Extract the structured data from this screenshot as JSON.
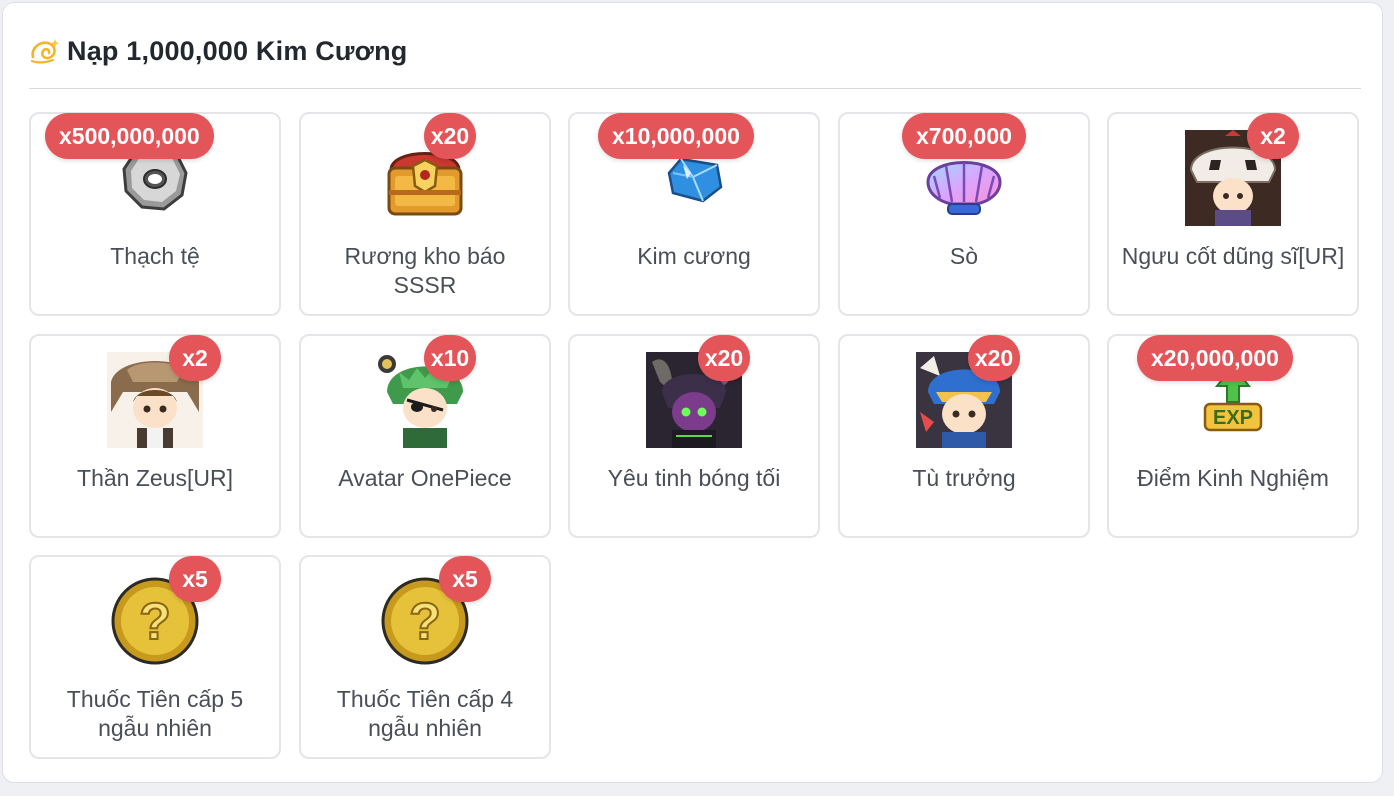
{
  "header": {
    "icon": "dizzy-icon",
    "title": "Nạp 1,000,000 Kim Cương"
  },
  "colors": {
    "badge": "#e4555a",
    "card_border": "#e3e5e9",
    "label_text": "#4a4f57"
  },
  "items": [
    {
      "name": "Thạch tệ",
      "qty": "x500,000,000",
      "icon": "stone-coin-icon"
    },
    {
      "name": "Rương kho báo SSSR",
      "qty": "x20",
      "icon": "treasure-chest-icon"
    },
    {
      "name": "Kim cương",
      "qty": "x10,000,000",
      "icon": "diamond-icon"
    },
    {
      "name": "Sò",
      "qty": "x700,000",
      "icon": "seashell-icon"
    },
    {
      "name": "Ngưu cốt dũng sĩ[UR]",
      "qty": "x2",
      "icon": "ox-skull-warrior-avatar-icon"
    },
    {
      "name": "Thần Zeus[UR]",
      "qty": "x2",
      "icon": "zeus-avatar-icon"
    },
    {
      "name": "Avatar OnePiece",
      "qty": "x10",
      "icon": "onepiece-avatar-icon"
    },
    {
      "name": "Yêu tinh bóng tối",
      "qty": "x20",
      "icon": "dark-elf-avatar-icon"
    },
    {
      "name": "Tù trưởng",
      "qty": "x20",
      "icon": "chief-avatar-icon"
    },
    {
      "name": "Điểm Kinh Nghiệm",
      "qty": "x20,000,000",
      "icon": "exp-icon"
    },
    {
      "name": "Thuốc Tiên cấp 5 ngẫu nhiên",
      "qty": "x5",
      "icon": "question-coin-icon"
    },
    {
      "name": "Thuốc Tiên cấp 4 ngẫu nhiên",
      "qty": "x5",
      "icon": "question-coin-icon"
    }
  ]
}
